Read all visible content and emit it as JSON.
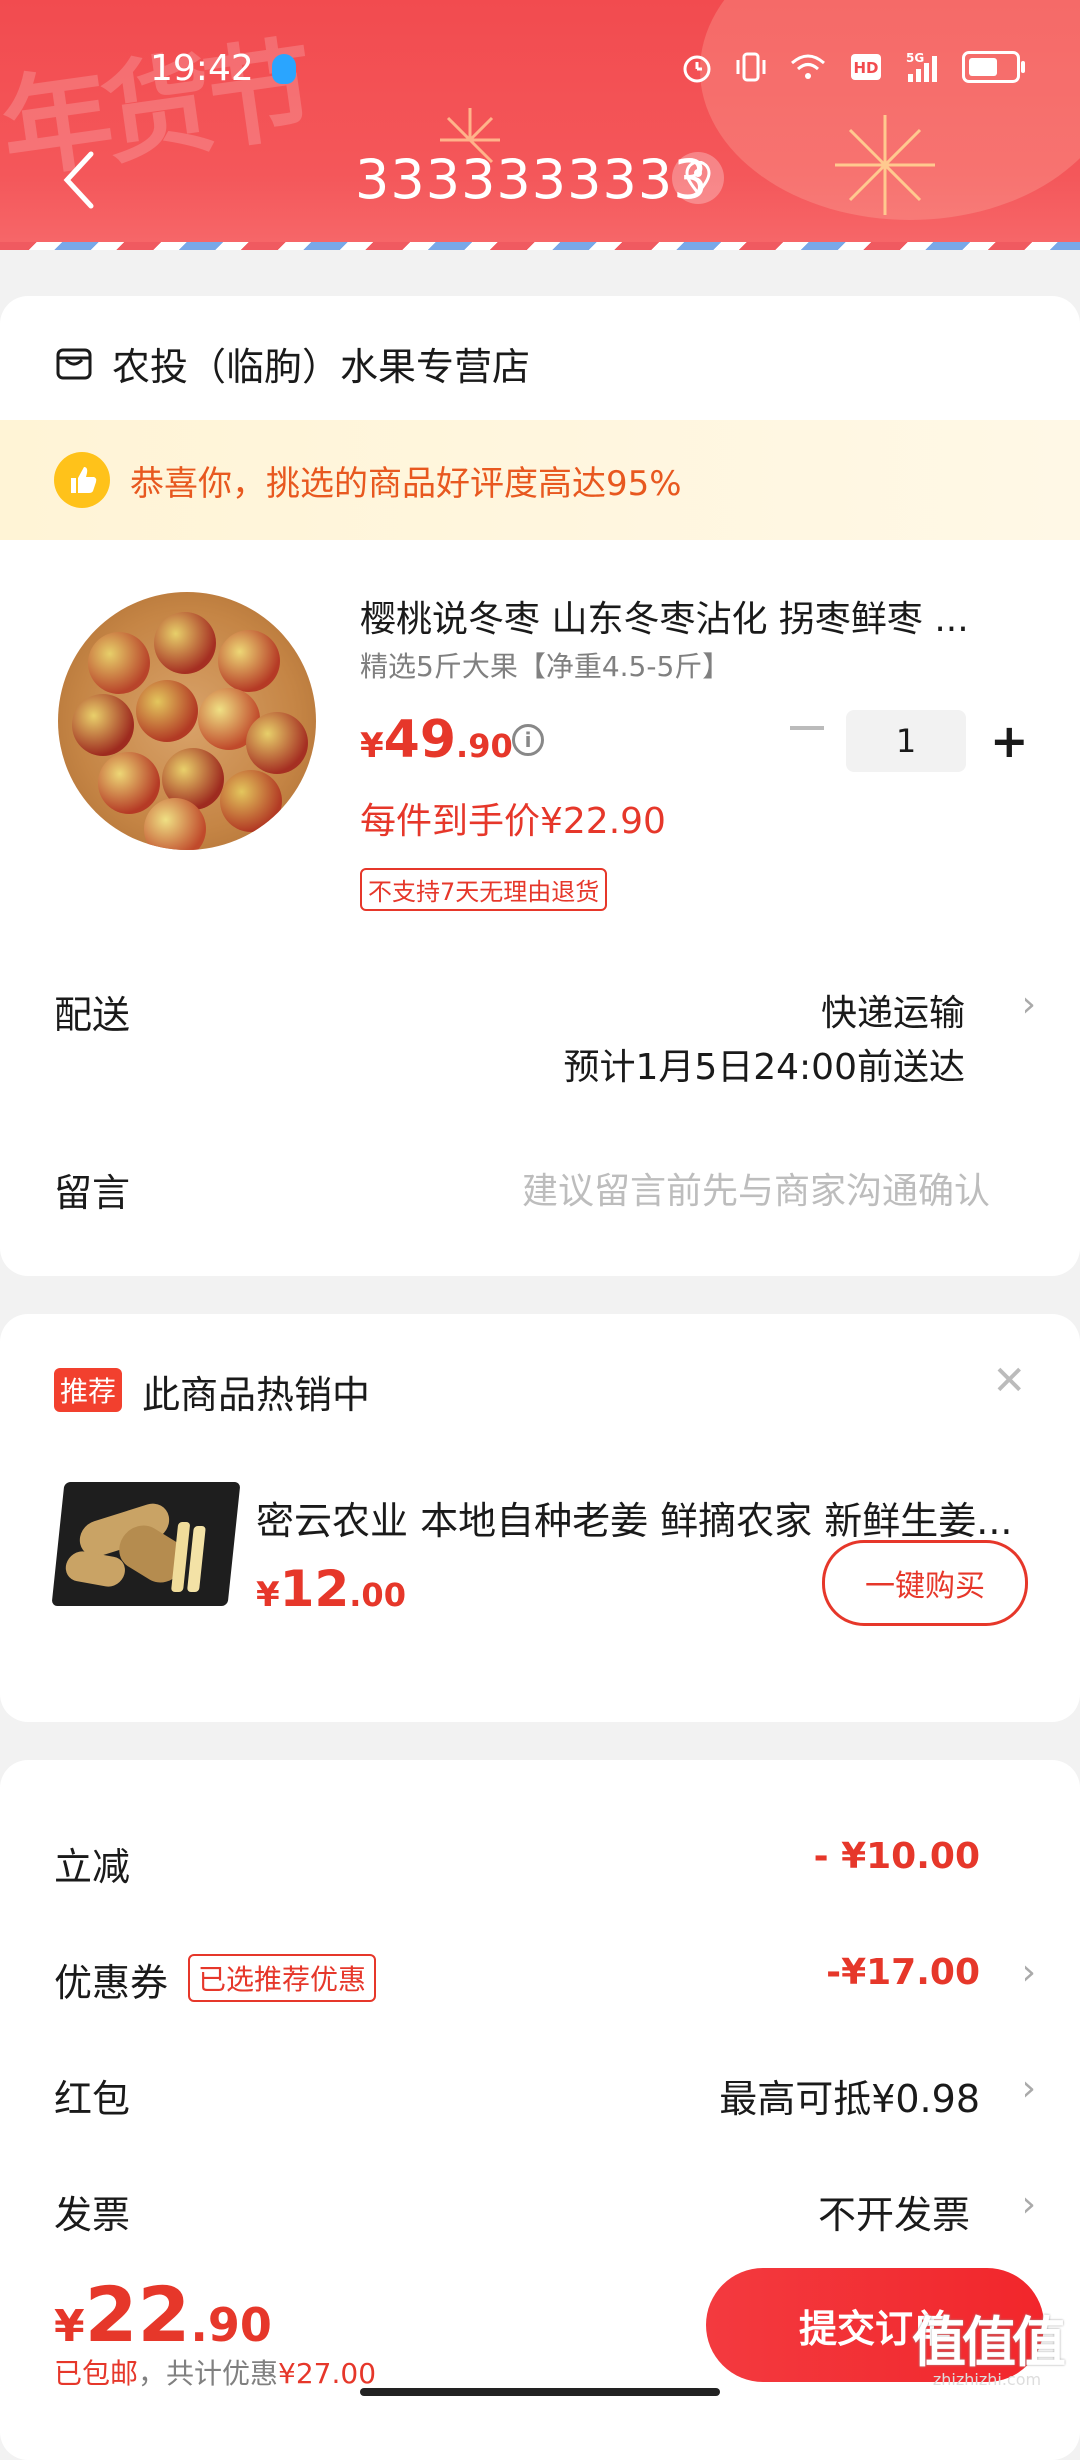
{
  "status_bar": {
    "time": "19:42",
    "network": "5G"
  },
  "header": {
    "title": "3333333333",
    "decoration": "年货节"
  },
  "store": {
    "name": "农投（临朐）水果专营店"
  },
  "banner": {
    "text": "恭喜你，挑选的商品好评度高达95%"
  },
  "product": {
    "title": "樱桃说冬枣 山东冬枣沾化 拐枣鲜枣 ...",
    "spec": "精选5斤大果【净重4.5-5斤】",
    "price_currency": "¥",
    "price_int": "49",
    "price_dec": ".90",
    "unit_price": "每件到手价¥22.90",
    "return_policy": "不支持7天无理由退货",
    "quantity": "1"
  },
  "delivery": {
    "label": "配送",
    "method": "快递运输",
    "eta": "预计1月5日24:00前送达"
  },
  "message": {
    "label": "留言",
    "placeholder": "建议留言前先与商家沟通确认"
  },
  "recommend": {
    "tag": "推荐",
    "title": "此商品热销中",
    "product_title": "密云农业 本地自种老姜 鲜摘农家 新鲜生姜...",
    "price_currency": "¥",
    "price_int": "12",
    "price_dec": ".00",
    "buy_label": "一键购买"
  },
  "discounts": {
    "instant": {
      "label": "立减",
      "value": "- ¥10.00"
    },
    "coupon": {
      "label": "优惠券",
      "tag": "已选推荐优惠",
      "value": "-¥17.00"
    },
    "redpacket": {
      "label": "红包",
      "value": "最高可抵¥0.98"
    },
    "invoice": {
      "label": "发票",
      "value": "不开发票"
    }
  },
  "footer": {
    "total_currency": "¥",
    "total_int": "22",
    "total_dec": ".90",
    "shipping": "已包邮",
    "separator": "，共计优惠",
    "saved": "¥27.00",
    "submit_label": "提交订单"
  },
  "watermark": {
    "logo": "值值值",
    "url": "zhizhizhi.com"
  },
  "colors": {
    "accent": "#e6372a",
    "header_red": "#f24b4f",
    "banner_bg": "#fff4d6"
  }
}
